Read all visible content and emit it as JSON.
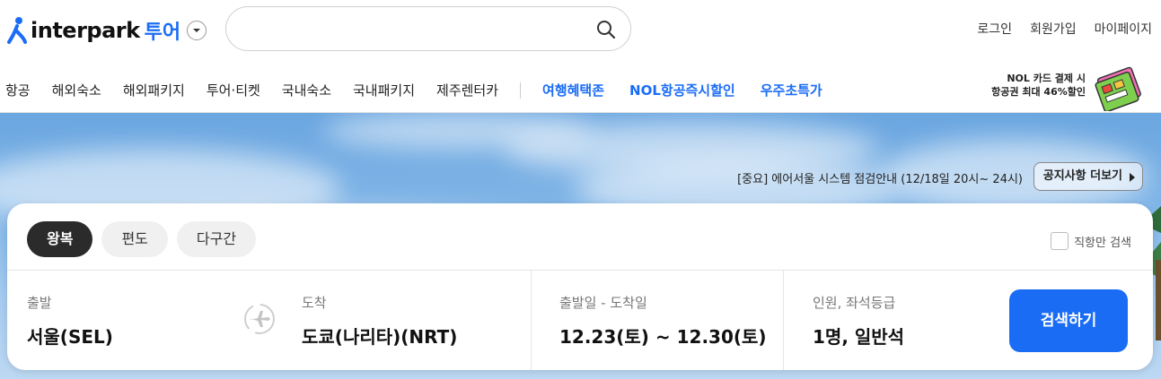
{
  "brand": {
    "name": "interpark",
    "sub": "투어"
  },
  "search": {
    "value": "",
    "placeholder": ""
  },
  "top_links": [
    "로그인",
    "회원가입",
    "마이페이지"
  ],
  "nav": {
    "items": [
      "항공",
      "해외숙소",
      "해외패키지",
      "투어·티켓",
      "국내숙소",
      "국내패키지",
      "제주렌터카"
    ],
    "highlight": [
      "여행혜택존",
      "NOL항공즉시할인",
      "우주초특가"
    ]
  },
  "promo": {
    "line1": "NOL 카드 결제 시",
    "line2": "항공권 최대 46%할인"
  },
  "notice": {
    "text": "[중요] 에어서울 시스템 점검안내 (12/18일 20시~ 24시)",
    "button": "공지사항 더보기"
  },
  "trip_types": [
    "왕복",
    "편도",
    "다구간"
  ],
  "direct_only": "직항만 검색",
  "fields": {
    "origin": {
      "label": "출발",
      "value": "서울(SEL)"
    },
    "destination": {
      "label": "도착",
      "value": "도쿄(나리타)(NRT)"
    },
    "dates": {
      "label": "출발일 - 도착일",
      "value": "12.23(토) ~ 12.30(토)"
    },
    "passengers": {
      "label": "인원, 좌석등급",
      "value": "1명, 일반석"
    }
  },
  "search_button": "검색하기",
  "colors": {
    "accent": "#1a6cf5",
    "active_tab": "#2b2b2b"
  }
}
